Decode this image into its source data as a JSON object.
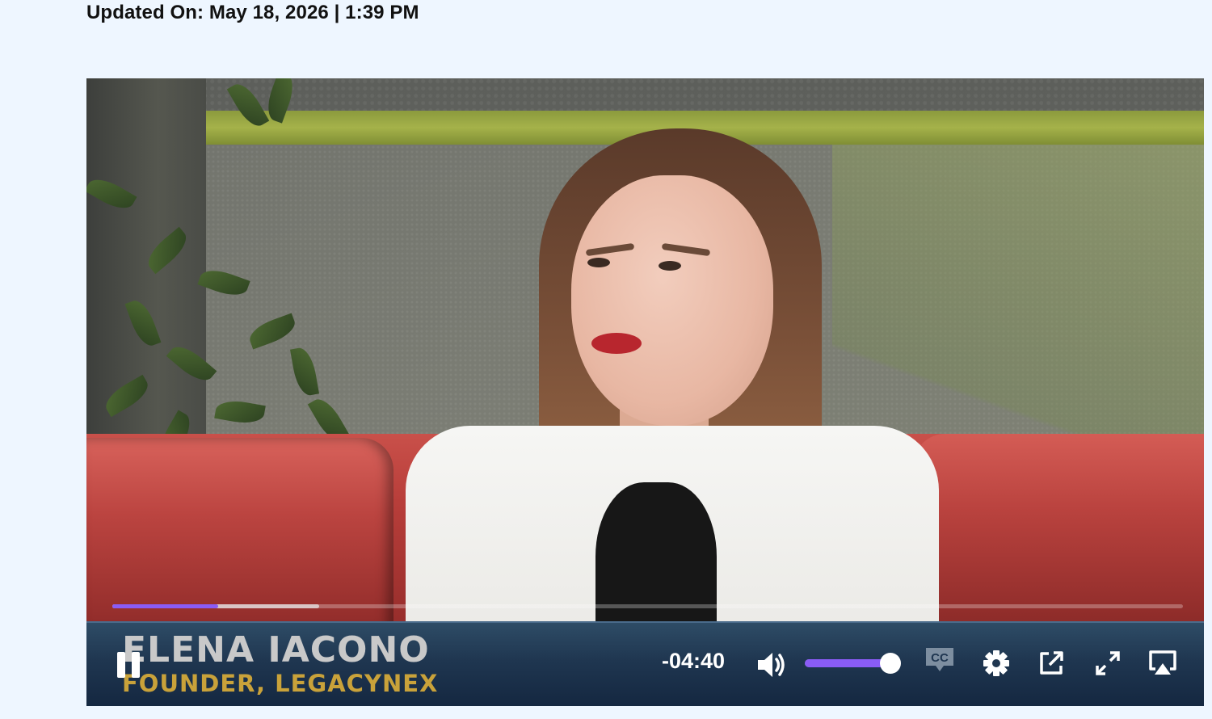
{
  "article": {
    "updated_label": "Updated On: May 18, 2026 | 1:39 PM"
  },
  "video": {
    "lower_third": {
      "name": "ELENA IACONO",
      "title": "FOUNDER, LEGACYNEX"
    },
    "progress": {
      "played_fraction": 0.099,
      "buffered_fraction": 0.193
    },
    "time_remaining": "-04:40",
    "volume_fraction": 0.98,
    "controls": {
      "pause_icon": "pause-icon",
      "volume_icon": "volume-icon",
      "cc_icon": "closed-captions-icon",
      "cc_label": "CC",
      "settings_icon": "gear-icon",
      "popout_icon": "popout-icon",
      "fullscreen_icon": "fullscreen-icon",
      "airplay_icon": "airplay-icon"
    },
    "accent_color": "#8a5cf6"
  }
}
